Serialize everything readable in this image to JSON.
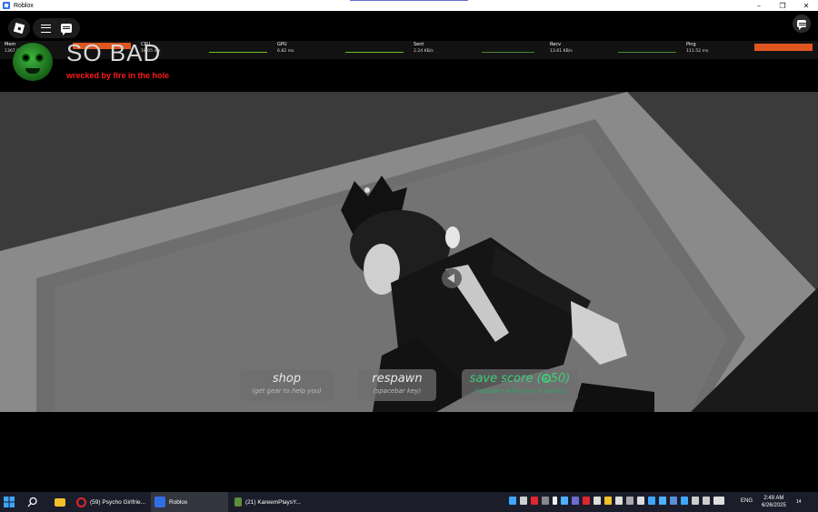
{
  "window": {
    "title": "Roblox",
    "controls": {
      "minimize": "–",
      "maximize": "❐",
      "close": "✕"
    }
  },
  "stats": {
    "mem_label": "Mem",
    "mem_value": "1367.88 MB",
    "cpu_label": "CPU",
    "cpu_value": "18.05 ms",
    "gpu_label": "GPU",
    "gpu_value": "6.82 ms",
    "sent_label": "Sent",
    "sent_value": "2.24 KB/s",
    "recv_label": "Recv",
    "recv_value": "13.61 KB/s",
    "ping_label": "Ping",
    "ping_value": "111.52 ms"
  },
  "death": {
    "headline": "SO BAD",
    "cause": "wrecked by fire in the hole"
  },
  "buttons": {
    "shop_label": "shop",
    "shop_hint": "(get gear to help you)",
    "respawn_label": "respawn",
    "respawn_hint": "(spacebar key)",
    "save_label": "save score (",
    "save_points": "50)",
    "save_hint": "(respawn with your 0 points)"
  },
  "taskbar": {
    "items": [
      {
        "label": "(59) Psycho Girlfrie..."
      },
      {
        "label": "Roblox"
      },
      {
        "label": "(21) KareemPlaysY..."
      }
    ],
    "language": "ENG",
    "time": "2:49 AM",
    "date": "6/26/2025",
    "notifications": "14"
  },
  "colors": {
    "accent_orange": "#e0561f",
    "death_red": "#ff1a1a",
    "save_green": "#3ccf7a"
  }
}
